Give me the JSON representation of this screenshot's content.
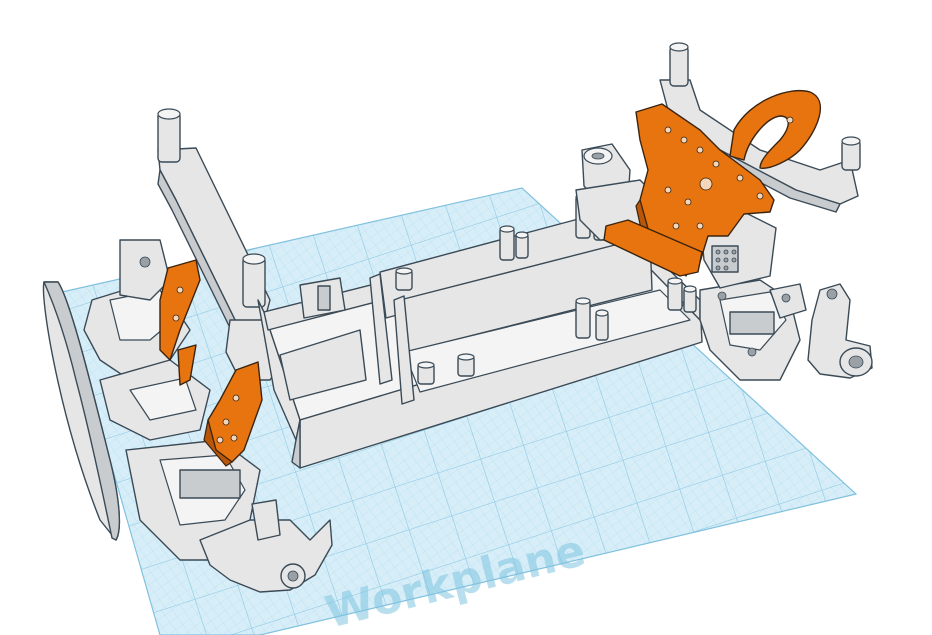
{
  "workplane": {
    "label": "Workplane",
    "grid_color": "#8ecbe6",
    "plane_color": "#d7eef8"
  },
  "model": {
    "body_color": "#e6e6e6",
    "accent_color": "#e8740f",
    "outline_color": "#3a4a56"
  }
}
